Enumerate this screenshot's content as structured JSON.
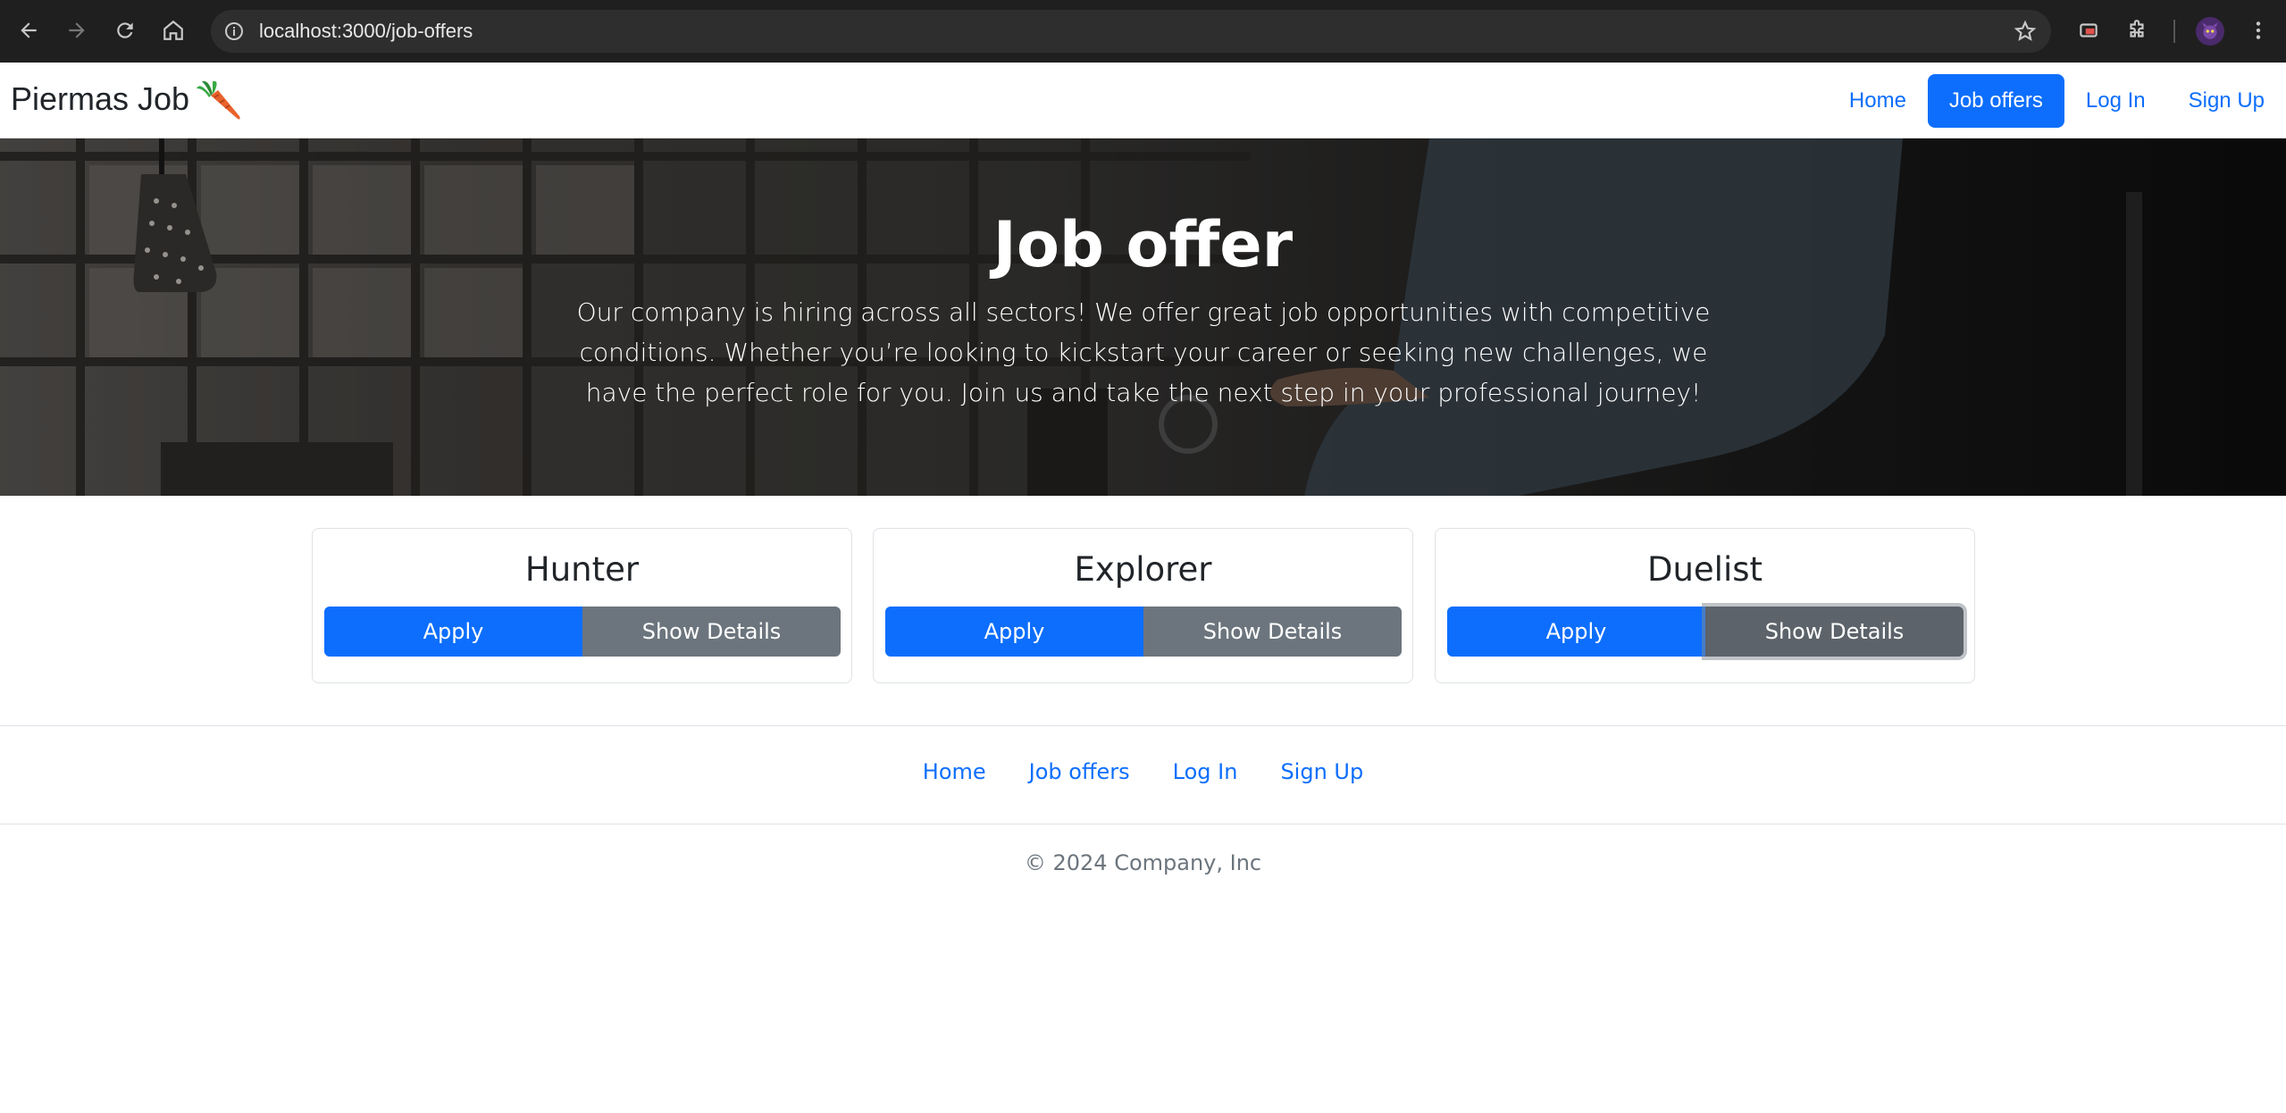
{
  "browser": {
    "url": "localhost:3000/job-offers",
    "icons": [
      "back-icon",
      "forward-icon",
      "reload-icon",
      "home-icon",
      "info-icon",
      "star-icon",
      "cast-icon",
      "extensions-icon",
      "profile-avatar",
      "menu-icon"
    ]
  },
  "navbar": {
    "brand": "Piermas Job",
    "brand_icon": "carrot-icon",
    "links": [
      {
        "label": "Home",
        "active": false
      },
      {
        "label": "Job offers",
        "active": true
      },
      {
        "label": "Log In",
        "active": false
      },
      {
        "label": "Sign Up",
        "active": false
      }
    ]
  },
  "hero": {
    "title": "Job offer",
    "text": "Our company is hiring across all sectors! We offer great job opportunities with competitive conditions. Whether you’re looking to kickstart your career or seeking new challenges, we have the perfect role for you. Join us and take the next step in your professional journey!"
  },
  "jobs": [
    {
      "title": "Hunter",
      "apply_label": "Apply",
      "details_label": "Show Details"
    },
    {
      "title": "Explorer",
      "apply_label": "Apply",
      "details_label": "Show Details"
    },
    {
      "title": "Duelist",
      "apply_label": "Apply",
      "details_label": "Show Details"
    }
  ],
  "footer": {
    "links": [
      "Home",
      "Job offers",
      "Log In",
      "Sign Up"
    ],
    "copyright": "© 2024 Company, Inc"
  },
  "colors": {
    "primary": "#0d6efd",
    "secondary": "#6c757d",
    "chrome_bg": "#1f1f1f"
  }
}
